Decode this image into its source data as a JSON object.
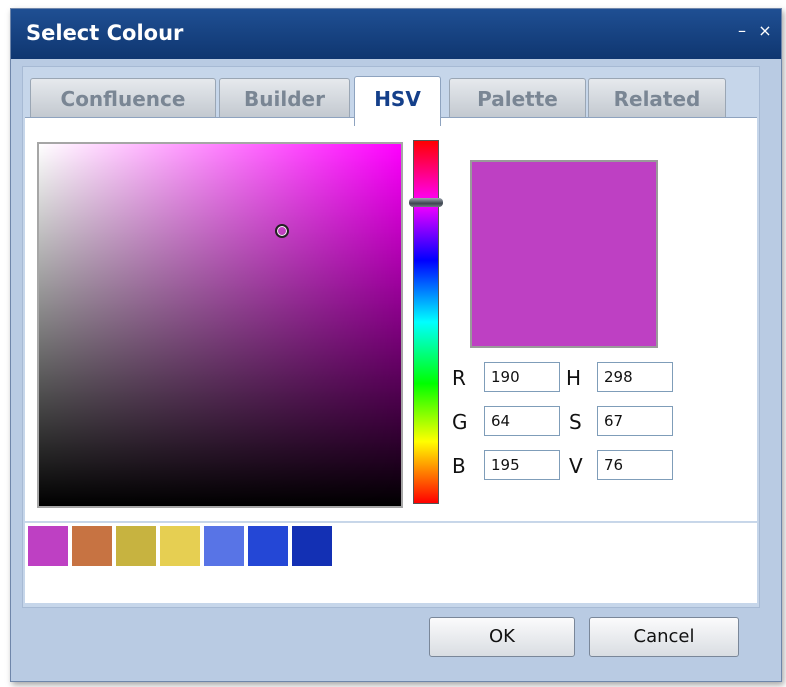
{
  "window": {
    "title": "Select Colour",
    "minimize_glyph": "–",
    "close_glyph": "×"
  },
  "tabs": [
    {
      "label": "Confluence",
      "active": false
    },
    {
      "label": "Builder",
      "active": false
    },
    {
      "label": "HSV",
      "active": true
    },
    {
      "label": "Palette",
      "active": false
    },
    {
      "label": "Related",
      "active": false
    }
  ],
  "hsv": {
    "hue_base_color": "#ff00ff",
    "saturation_pct": 67,
    "value_pct": 76,
    "hue_deg": 298
  },
  "preview_color": "#be40c3",
  "fields": {
    "r": {
      "label": "R",
      "value": "190"
    },
    "g": {
      "label": "G",
      "value": "64"
    },
    "b": {
      "label": "B",
      "value": "195"
    },
    "h": {
      "label": "H",
      "value": "298"
    },
    "s": {
      "label": "S",
      "value": "67"
    },
    "v": {
      "label": "V",
      "value": "76"
    }
  },
  "recent_swatches": [
    "#be40c3",
    "#c77342",
    "#c7b340",
    "#e6cf52",
    "#5874e6",
    "#2447d6",
    "#1330b4"
  ],
  "buttons": {
    "ok": "OK",
    "cancel": "Cancel"
  }
}
